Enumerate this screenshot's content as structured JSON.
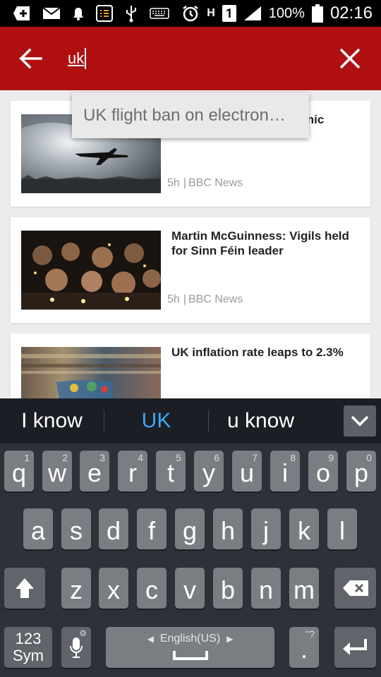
{
  "status_bar": {
    "left_icons": [
      "add-icon",
      "email-icon",
      "notification-bell-icon",
      "list-app-icon",
      "usb-icon",
      "keyboard-icon"
    ],
    "alarm_icon": "alarm-icon",
    "network_label": "H",
    "sim_label": "1",
    "battery": "100%",
    "time": "02:16"
  },
  "app_bar": {
    "search_value": "uk",
    "color": "#b01010"
  },
  "suggestion": {
    "text": "UK flight ban on electron…"
  },
  "articles": [
    {
      "headline": "UK flight ban on electronic devices announced",
      "time": "5h",
      "source": "BBC News"
    },
    {
      "headline": "Martin McGuinness: Vigils held for Sinn Féin leader",
      "time": "5h",
      "source": "BBC News"
    },
    {
      "headline": "UK inflation rate leaps to 2.3%",
      "time": "",
      "source": ""
    }
  ],
  "keyboard": {
    "suggestions": [
      "I know",
      "UK",
      "u know"
    ],
    "selected_suggestion_color": "#3ea6f0",
    "row1": [
      "q",
      "w",
      "e",
      "r",
      "t",
      "y",
      "u",
      "i",
      "o",
      "p"
    ],
    "row1_sub": [
      "1",
      "2",
      "3",
      "4",
      "5",
      "6",
      "7",
      "8",
      "9",
      "0"
    ],
    "row2": [
      "a",
      "s",
      "d",
      "f",
      "g",
      "h",
      "j",
      "k",
      "l"
    ],
    "row3": [
      "z",
      "x",
      "c",
      "v",
      "b",
      "n",
      "m"
    ],
    "sym_line1": "123",
    "sym_line2": "Sym",
    "language": "English(US)",
    "period": ".",
    "period_sub": "\"?"
  }
}
